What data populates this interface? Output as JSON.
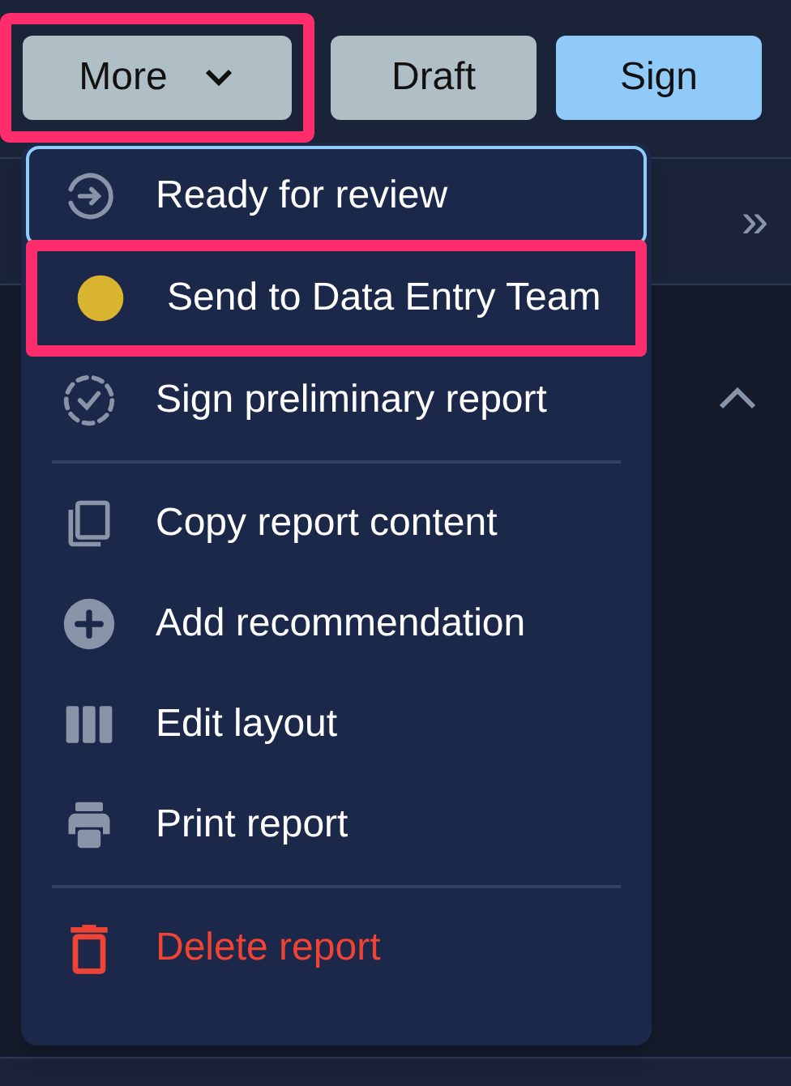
{
  "toolbar": {
    "buttons": [
      {
        "label": "More",
        "kind": "dropdown",
        "highlighted": true,
        "color": "#b0bec5"
      },
      {
        "label": "Draft",
        "kind": "plain",
        "highlighted": false,
        "color": "#b0bec5"
      },
      {
        "label": "Sign",
        "kind": "plain",
        "highlighted": false,
        "color": "#90caf9"
      }
    ]
  },
  "panel": {
    "expand_icon": "»"
  },
  "menu": {
    "sections": [
      {
        "items": [
          {
            "label": "Ready for review",
            "focused": true,
            "highlighted": false,
            "danger": false
          },
          {
            "label": "Send to Data Entry Team",
            "focused": false,
            "highlighted": true,
            "danger": false,
            "color": "#d9b52f"
          },
          {
            "label": "Sign preliminary report",
            "focused": false,
            "highlighted": false,
            "danger": false
          }
        ]
      },
      {
        "items": [
          {
            "label": "Copy report content",
            "focused": false,
            "highlighted": false,
            "danger": false
          },
          {
            "label": "Add recommendation",
            "focused": false,
            "highlighted": false,
            "danger": false
          },
          {
            "label": "Edit layout",
            "focused": false,
            "highlighted": false,
            "danger": false
          },
          {
            "label": "Print report",
            "focused": false,
            "highlighted": false,
            "danger": false
          }
        ]
      },
      {
        "items": [
          {
            "label": "Delete report",
            "focused": false,
            "highlighted": false,
            "danger": true
          }
        ]
      }
    ]
  }
}
